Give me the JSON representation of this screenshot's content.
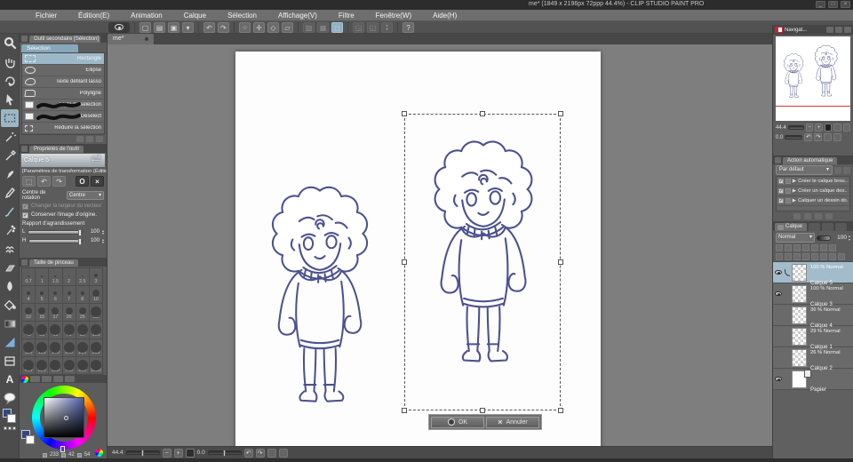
{
  "window": {
    "title": "me* (1849 x 2196px 72ppp 44.4%) - CLIP STUDIO PAINT PRO"
  },
  "icons": {
    "minimize": "_",
    "maximize": "□",
    "close": "×",
    "undo": "↶",
    "redo": "↷",
    "dropdown": "▾",
    "play": "▶",
    "check": "✓",
    "help": "?",
    "zoom_out": "−",
    "zoom_in": "+",
    "stepper_up": "▴",
    "stepper_down": "▾"
  },
  "menu": {
    "items": [
      {
        "label": "Fichier"
      },
      {
        "label": "Édition(E)"
      },
      {
        "label": "Animation"
      },
      {
        "label": "Calque"
      },
      {
        "label": "Sélection"
      },
      {
        "label": "Affichage(V)"
      },
      {
        "label": "Filtre"
      },
      {
        "label": "Fenêtre(W)"
      },
      {
        "label": "Aide(H)"
      }
    ]
  },
  "canvas": {
    "tab_label": "me*",
    "ok_label": "OK",
    "cancel_label": "Annuler",
    "status": {
      "zoom": "44.4",
      "rotation": "0.0"
    }
  },
  "subtool": {
    "title": "Outil secondaire [Sélection]",
    "group_tab": "Sélection",
    "items": [
      {
        "label": "Rectangle",
        "class": "selected ic-rect"
      },
      {
        "label": "Ellipse",
        "class": "ic-ellipse"
      },
      {
        "label": "Texte défilant lasso",
        "class": "ic-lasso"
      },
      {
        "label": "Polyligne",
        "class": "ic-poly"
      },
      {
        "label": "Stylo de sélection",
        "class": "ic-squiggle"
      },
      {
        "label": "Désélect",
        "class": "ic-squiggle"
      },
      {
        "label": "Réduire la sélection",
        "class": "ic-shrink"
      }
    ]
  },
  "tool_property": {
    "title": "Propriétés de l'outil",
    "context_label": "Calque 5",
    "subtitle": "[Paramètres de transformation (Édition ]",
    "rotation_center_label": "Centre de rotation",
    "rotation_center_value": "Centre",
    "checkbox_vector": "Changer la largeur du vecteur",
    "checkbox_keep": "Conserver l'image d'origine.",
    "scale_label": "Rapport d'agrandissement",
    "scale_rows": [
      {
        "axis": "L",
        "value": "100"
      },
      {
        "axis": "H",
        "value": "100"
      }
    ]
  },
  "brush_size": {
    "title": "Taille de pinceau",
    "sizes": [
      {
        "label": "0.7"
      },
      {
        "label": "1"
      },
      {
        "label": "1.5"
      },
      {
        "label": "2"
      },
      {
        "label": "2.5"
      },
      {
        "label": "3"
      },
      {
        "label": "4"
      },
      {
        "label": "5"
      },
      {
        "label": "6"
      },
      {
        "label": "7"
      },
      {
        "label": "8"
      },
      {
        "label": "10"
      },
      {
        "label": "12"
      },
      {
        "label": "15"
      },
      {
        "label": "17"
      },
      {
        "label": "20"
      },
      {
        "label": "25"
      },
      {
        "label": "30"
      },
      {
        "label": "40"
      },
      {
        "label": "50"
      },
      {
        "label": "60"
      },
      {
        "label": "70"
      },
      {
        "label": "80"
      },
      {
        "label": "100"
      },
      {
        "label": "120"
      },
      {
        "label": "150"
      },
      {
        "label": "170"
      },
      {
        "label": "200"
      },
      {
        "label": "250"
      },
      {
        "label": "300"
      },
      {
        "label": "400"
      },
      {
        "label": "500"
      },
      {
        "label": "600"
      },
      {
        "label": "700"
      },
      {
        "label": "800"
      },
      {
        "label": "1000"
      }
    ]
  },
  "color_panel": {
    "values": [
      {
        "v": "233"
      },
      {
        "v": "42"
      },
      {
        "v": "54"
      }
    ]
  },
  "navigator": {
    "title": "Navigat...",
    "zoom": "44.4",
    "rotation": "0.0"
  },
  "auto_action": {
    "title": "Action automatique",
    "preset": "Par défaut",
    "items": [
      {
        "label": "Créer le calque brou..."
      },
      {
        "label": "Créer un calque des..."
      },
      {
        "label": "Calquer un dessin do..."
      }
    ]
  },
  "layer_panel": {
    "tab": "Calque",
    "blend_mode": "Normal",
    "opacity": "100",
    "items": [
      {
        "opacity": "100 %",
        "mode": "Normal",
        "name": "Calque 5",
        "class": "selected has-eye has-pen"
      },
      {
        "opacity": "100 %",
        "mode": "Normal",
        "name": "Calque 3",
        "class": "has-eye"
      },
      {
        "opacity": "36 %",
        "mode": "Normal",
        "name": "Calque 4",
        "class": ""
      },
      {
        "opacity": "29 %",
        "mode": "Normal",
        "name": "Calque 1",
        "class": ""
      },
      {
        "opacity": "26 %",
        "mode": "Normal",
        "name": "Calque 2",
        "class": ""
      },
      {
        "opacity": "",
        "mode": "",
        "name": "Papier",
        "class": "paper has-eye"
      }
    ]
  }
}
